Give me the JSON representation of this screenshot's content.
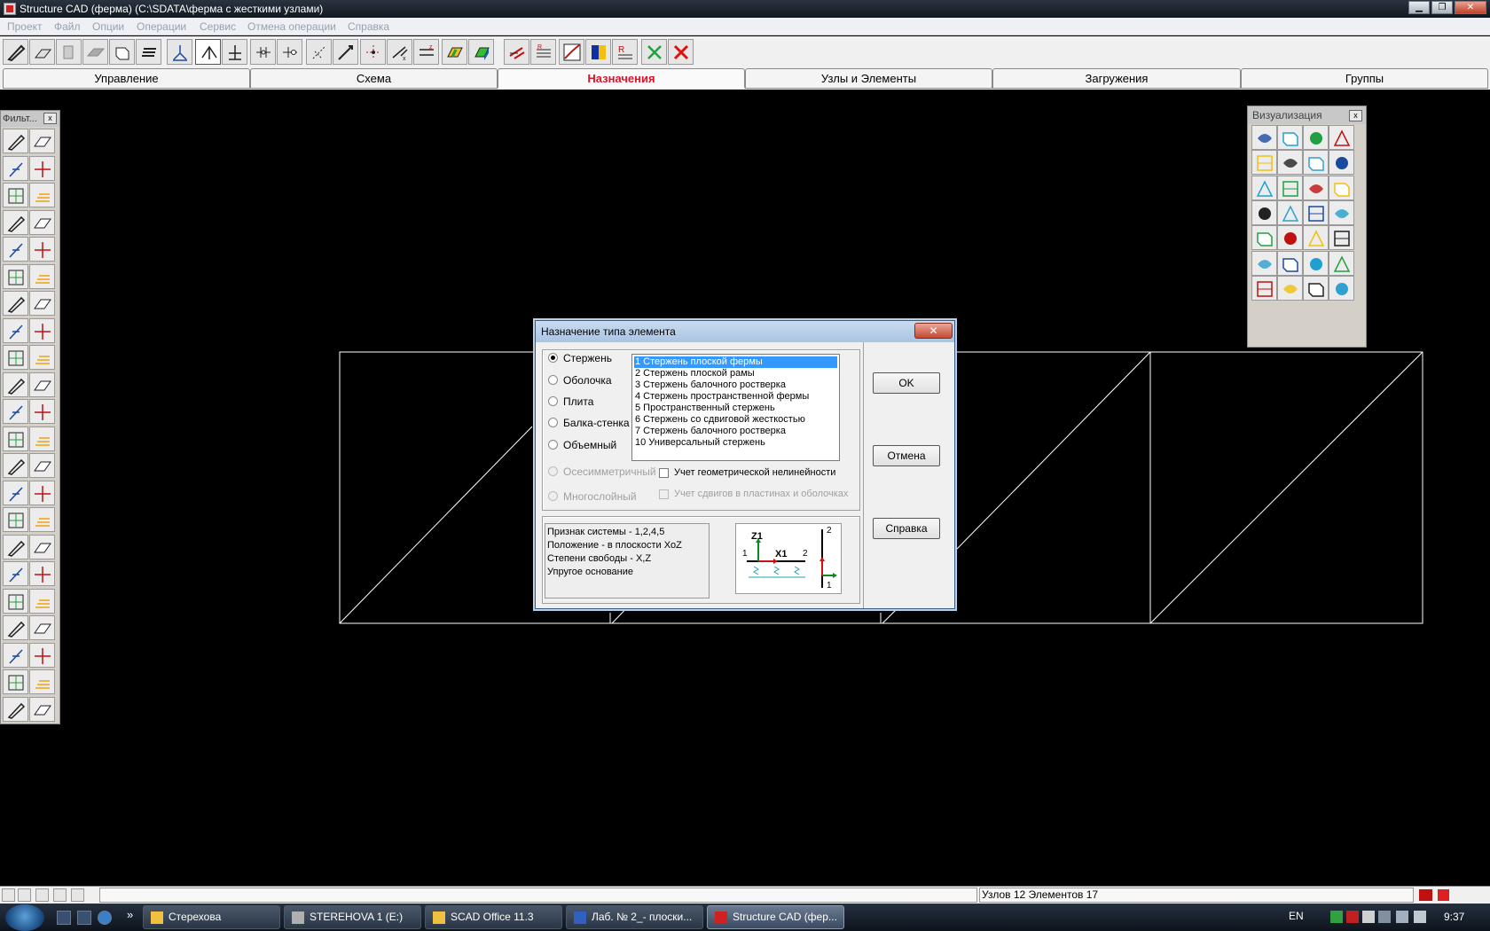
{
  "window": {
    "title": "Structure CAD (ферма) (C:\\SDATA\\ферма с жесткими узлами)",
    "minimize_glyph": "▁",
    "restore_glyph": "❐",
    "close_glyph": "✕"
  },
  "menu": [
    "Проект",
    "Файл",
    "Опции",
    "Операции",
    "Сервис",
    "Отмена операции",
    "Справка"
  ],
  "tabs": [
    "Управление",
    "Схема",
    "Назначения",
    "Узлы и Элементы",
    "Загружения",
    "Группы"
  ],
  "active_tab": "Назначения",
  "filter_panel": {
    "title": "Фильт...",
    "close_glyph": "x"
  },
  "vis_panel": {
    "title": "Визуализация",
    "close_glyph": "x"
  },
  "dialog": {
    "title": "Назначение типа элемента",
    "close_glyph": "✕",
    "element_kinds": [
      {
        "label": "Стержень",
        "checked": true,
        "enabled": true
      },
      {
        "label": "Оболочка",
        "checked": false,
        "enabled": true
      },
      {
        "label": "Плита",
        "checked": false,
        "enabled": true
      },
      {
        "label": "Балка-стенка",
        "checked": false,
        "enabled": true
      },
      {
        "label": "Объемный",
        "checked": false,
        "enabled": true
      },
      {
        "label": "Осесимметричный",
        "checked": false,
        "enabled": false
      },
      {
        "label": "Многослойный",
        "checked": false,
        "enabled": false
      }
    ],
    "types": [
      "1 Стержень плоской фермы",
      "2 Стержень плоской рамы",
      "3 Стержень балочного ростверка",
      "4 Стержень пространственной фермы",
      "5 Пространственный стержень",
      "6 Стержень со сдвиговой жесткостью",
      "7 Стержень балочного ростверка",
      "10 Универсальный стержень"
    ],
    "selected_type": "1 Стержень плоской фермы",
    "checkboxes": [
      {
        "label": "Учет геометрической нелинейности",
        "enabled": true
      },
      {
        "label": "Учет сдвигов в пластинах и оболочках",
        "enabled": false
      }
    ],
    "info": [
      "Признак системы - 1,2,4,5",
      "Положение - в плоскости XoZ",
      "Степени свободы - X,Z",
      "Упругое основание"
    ],
    "scheme_labels": {
      "z_axis": "Z1",
      "x_axis": "X1",
      "node_1": "1",
      "node_2": "2"
    },
    "buttons": {
      "ok": "OK",
      "cancel": "Отмена",
      "help": "Справка"
    }
  },
  "status": {
    "info": "Узлов 12 Элементов 17"
  },
  "taskbar": {
    "tasks": [
      "Стерехова",
      "STEREHOVA 1 (E:)",
      "SCAD Office 11.3",
      "Лаб. № 2_- плоски...",
      "Structure CAD (фер..."
    ],
    "more_glyph": "»",
    "lang": "EN",
    "clock": "9:37"
  },
  "colors": {
    "accent_tab": "#e0102a",
    "selection": "#3399ff",
    "canvas": "#000000",
    "truss_lines": "#ffffff"
  }
}
